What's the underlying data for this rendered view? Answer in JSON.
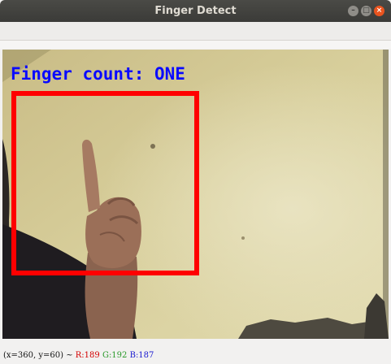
{
  "window": {
    "title": "Finger Detect"
  },
  "overlay": {
    "text": "Finger count: ONE",
    "text_color": "#0a0aff",
    "box_color": "#ff0000"
  },
  "status": {
    "coords": "(x=360, y=60) ~ ",
    "r": "R:189",
    "g": "G:192",
    "b": "B:187"
  }
}
